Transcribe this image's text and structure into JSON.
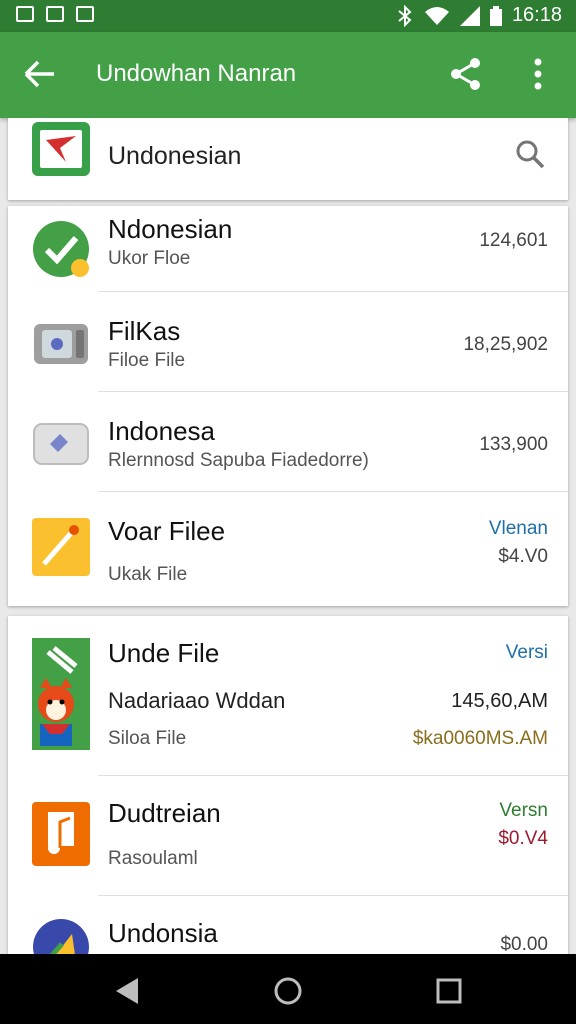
{
  "status_bar": {
    "time": "16:18"
  },
  "app_bar": {
    "title": "Undowhan Nanran"
  },
  "search_row": {
    "label": "Undonesian"
  },
  "card1": {
    "rows": [
      {
        "title": "Ndonesian",
        "subtitle": "Ukor Floe",
        "value": "124,601"
      },
      {
        "title": "FilKas",
        "subtitle": "Filoe File",
        "value": "18,25,902"
      },
      {
        "title": "Indonesa",
        "subtitle": "Rlernnosd Sapuba Fiadedorre)",
        "value": "133,900"
      },
      {
        "title": "Voar Filee",
        "subtitle": "Ukak File",
        "value_top": "Vlenan",
        "value": "$4.V0"
      }
    ]
  },
  "card2": {
    "rows": [
      {
        "title": "Unde File",
        "value_top": "Versi",
        "line2": "Nadariaao Wddan",
        "line2_value": "145,60,AM",
        "subtitle": "Siloa File",
        "value": "$ka0060MS.AM"
      },
      {
        "title": "Dudtreian",
        "subtitle": "Rasoulaml",
        "value_top": "Versn",
        "value": "$0.V4"
      },
      {
        "title": "Undonsia",
        "value": "$0.00"
      }
    ]
  },
  "colors": {
    "status_bar": "#2e7d32",
    "app_bar": "#43a047",
    "link_blue": "#1e6fa8",
    "price_green": "#2e7d32",
    "price_red": "#9b1c31",
    "price_gold": "#8a6d1d"
  }
}
